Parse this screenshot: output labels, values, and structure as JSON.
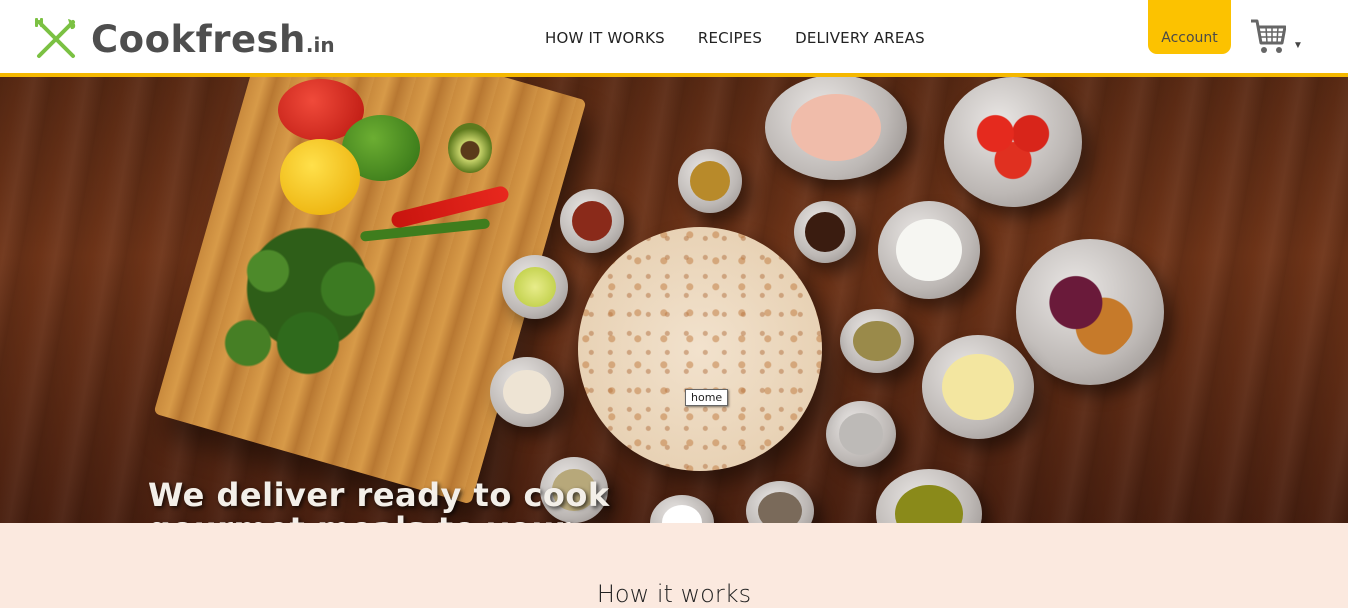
{
  "brand": {
    "name": "Cookfresh",
    "suffix": ".in",
    "logo_icon": "fork-knife-cross-icon",
    "accent": "#f5b800",
    "icon_color": "#7bc143"
  },
  "nav": {
    "items": [
      {
        "label": "HOW IT WORKS"
      },
      {
        "label": "RECIPES"
      },
      {
        "label": "DELIVERY AREAS"
      }
    ]
  },
  "account": {
    "label": "Account",
    "color": "#fcc200"
  },
  "cart": {
    "icon": "shopping-cart-icon",
    "caret": "▼"
  },
  "hero": {
    "tooltip": "home",
    "tagline": "We deliver ready to cook gourmet meals to your doorstep"
  },
  "section": {
    "title": "How it works"
  }
}
